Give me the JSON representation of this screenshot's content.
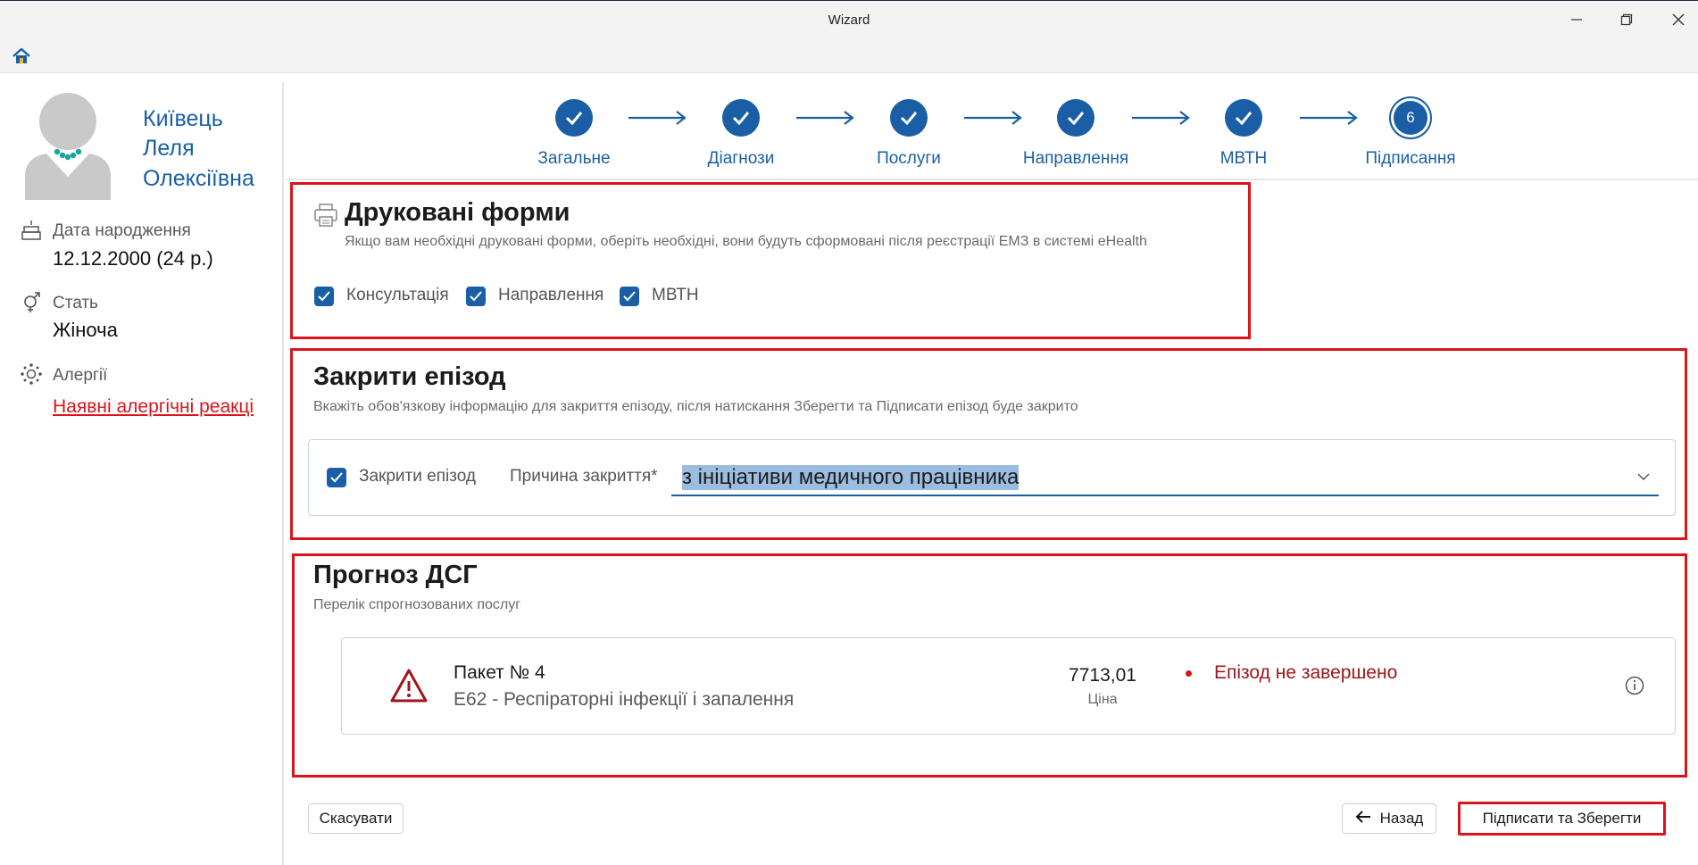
{
  "window": {
    "title": "Wizard"
  },
  "patient": {
    "name_line1": "Київець",
    "name_line2": "Леля",
    "name_line3": "Олексіївна",
    "birth_label": "Дата народження",
    "birth_value": "12.12.2000 (24 р.)",
    "sex_label": "Стать",
    "sex_value": "Жіноча",
    "allergy_label": "Алергії",
    "allergy_link": "Наявні алергічні реакці"
  },
  "stepper": {
    "steps": [
      {
        "label": "Загальне"
      },
      {
        "label": "Діагнози"
      },
      {
        "label": "Послуги"
      },
      {
        "label": "Направлення"
      },
      {
        "label": "МВТН"
      },
      {
        "label": "Підписання",
        "number": "6"
      }
    ]
  },
  "print_forms": {
    "title": "Друковані форми",
    "subtitle": "Якщо вам необхідні друковані форми, оберіть необхідні, вони будуть сформовані після реєстрації ЕМЗ в системі eHealth",
    "options": [
      {
        "label": "Консультація"
      },
      {
        "label": "Направлення"
      },
      {
        "label": "МВТН"
      }
    ]
  },
  "close_episode": {
    "title": "Закрити епізод",
    "subtitle": "Вкажіть обов'язкову інформацію для закриття епізоду, після натискання Зберегти та Підписати епізод буде закрито",
    "checkbox_label": "Закрити епізод",
    "reason_label": "Причина закриття*",
    "reason_value": "з ініціативи медичного працівника"
  },
  "dsg": {
    "title": "Прогноз ДСГ",
    "subtitle": "Перелік спрогнозованих послуг",
    "package_title": "Пакет № 4",
    "package_desc": "E62 - Респіраторні інфекції і запалення",
    "price_value": "7713,01",
    "price_label": "Ціна",
    "status": "Епізод не завершено"
  },
  "footer": {
    "cancel": "Скасувати",
    "back": "Назад",
    "sign_save": "Підписати та Зберегти"
  },
  "colors": {
    "accent": "#1a5fa5",
    "highlight": "#d9141b",
    "status_red": "#a0151b"
  }
}
